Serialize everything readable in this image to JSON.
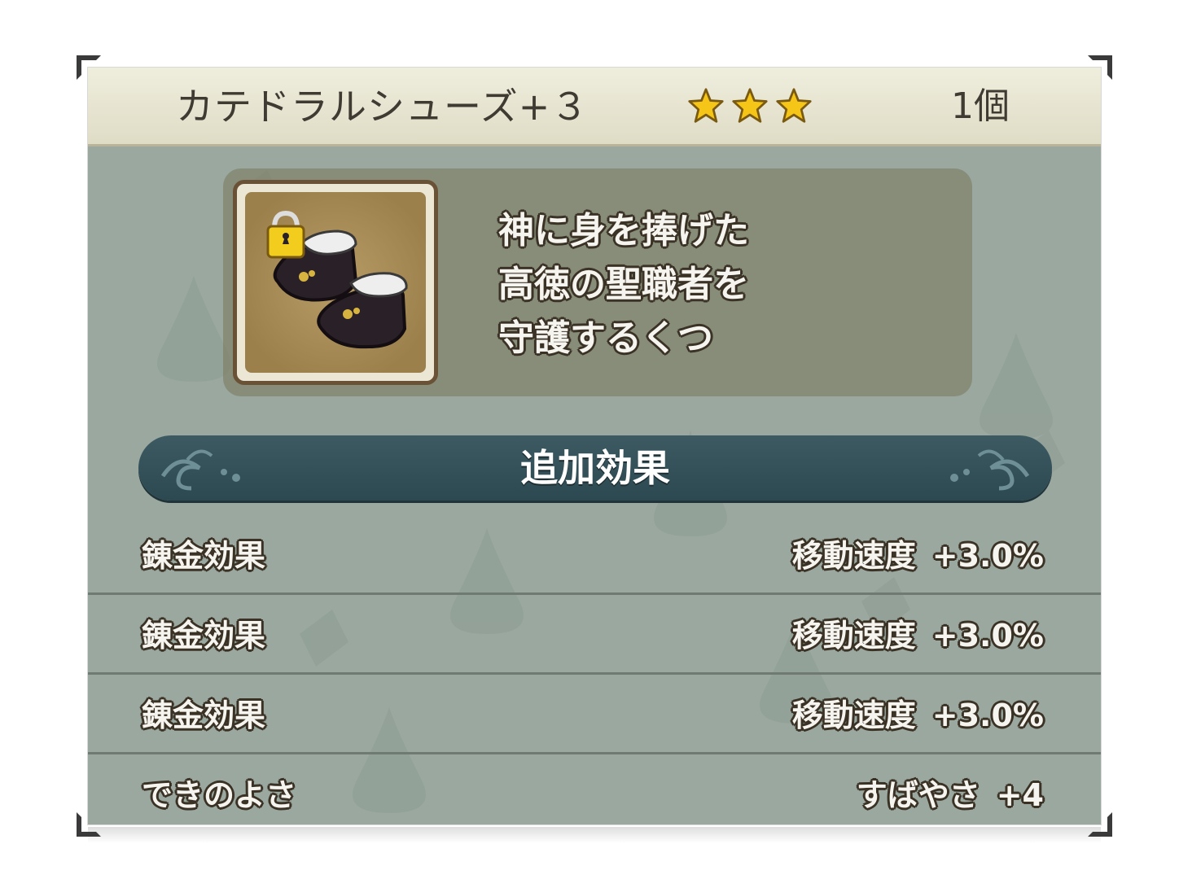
{
  "item": {
    "name": "カテドラルシューズ+３",
    "rarity_stars": 3,
    "count": "1個",
    "icon": "boots-icon",
    "lock_icon": "lock-icon",
    "description": [
      "神に身を捧げた",
      "高徳の聖職者を",
      "守護するくつ"
    ]
  },
  "section": {
    "title": "追加効果"
  },
  "effects": [
    {
      "label": "錬金効果",
      "stat": "移動速度",
      "amount": "+3.0%"
    },
    {
      "label": "錬金効果",
      "stat": "移動速度",
      "amount": "+3.0%"
    },
    {
      "label": "錬金効果",
      "stat": "移動速度",
      "amount": "+3.0%"
    },
    {
      "label": "できのよさ",
      "stat": "すばやさ",
      "amount": "+4"
    }
  ],
  "colors": {
    "header_bg": "#e8e6d2",
    "panel_bg": "#9aa8a0",
    "banner_bg": "#35525b",
    "star": "#f5c518"
  }
}
